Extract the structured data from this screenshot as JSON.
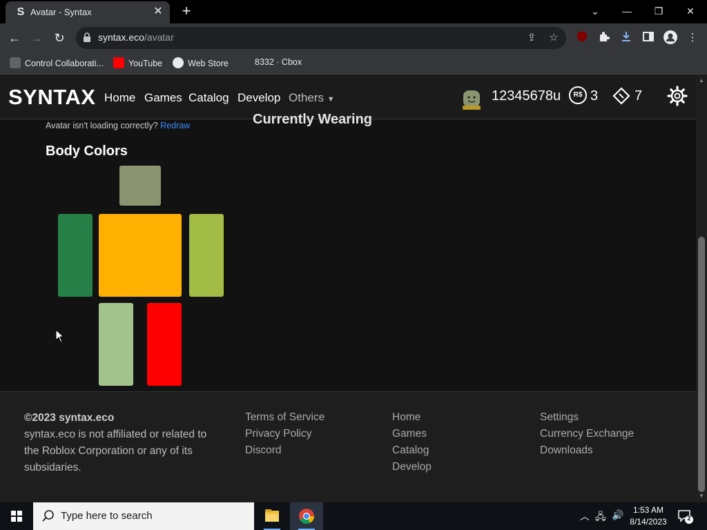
{
  "browser": {
    "tab_title": "Avatar - Syntax",
    "tab_favicon_letter": "S",
    "url_domain": "syntax.eco",
    "url_path": "/avatar",
    "bookmarks": [
      "Control Collaborati...",
      "YouTube",
      "Web Store",
      "8332 · Cbox"
    ]
  },
  "header": {
    "logo": "SYNTAX",
    "nav": [
      "Home",
      "Games",
      "Catalog",
      "Develop",
      "Others"
    ],
    "username": "12345678u",
    "robux_symbol": "R$",
    "robux": "3",
    "tix": "7"
  },
  "main": {
    "redraw_note": "Avatar isn't loading correctly?",
    "redraw_link": "Redraw",
    "currently_wearing": "Currently Wearing",
    "body_colors_title": "Body Colors",
    "body_colors": {
      "head": "#8a9470",
      "torso": "#ffb000",
      "left_arm": "#268047",
      "right_arm": "#a3bc46",
      "left_leg": "#a2c48c",
      "right_leg": "#ff0000"
    }
  },
  "footer": {
    "copyright": "©2023 syntax.eco",
    "disclaimer_lines": [
      "syntax.eco is not affiliated or related to",
      "the Roblox Corporation or any of its",
      "subsidaries."
    ],
    "col1": [
      "Terms of Service",
      "Privacy Policy",
      "Discord"
    ],
    "col2": [
      "Home",
      "Games",
      "Catalog",
      "Develop"
    ],
    "col3": [
      "Settings",
      "Currency Exchange",
      "Downloads"
    ]
  },
  "taskbar": {
    "search_placeholder": "Type here to search",
    "time": "1:53 AM",
    "date": "8/14/2023",
    "notification_count": "2"
  }
}
